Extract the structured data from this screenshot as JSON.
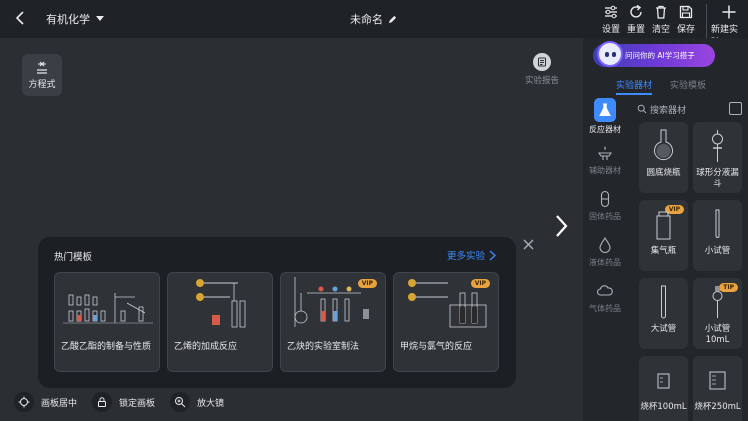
{
  "topbar": {
    "subject": "有机化学",
    "title": "未命名",
    "tools": {
      "settings": "设置",
      "reset": "重置",
      "clear": "清空",
      "save": "保存",
      "new_experiment": "新建实验"
    }
  },
  "canvas": {
    "equation_label": "方程式",
    "report_label": "实验报告"
  },
  "templates": {
    "heading": "热门模板",
    "more": "更多实验",
    "cards": [
      {
        "label": "乙酸乙酯的制备与性质",
        "vip": ""
      },
      {
        "label": "乙烯的加成反应",
        "vip": ""
      },
      {
        "label": "乙炔的实验室制法",
        "vip": "VIP"
      },
      {
        "label": "甲烷与氯气的反应",
        "vip": "VIP"
      }
    ]
  },
  "bottom_controls": {
    "center": "画板居中",
    "lock": "锁定画板",
    "magnifier": "放大镜"
  },
  "panel": {
    "ai_banner": "问问你的 AI学习搭子",
    "tabs": {
      "equipment": "实验器材",
      "templates": "实验模板"
    },
    "categories": [
      {
        "label": "反应器材",
        "icon": "flask-icon",
        "active": true
      },
      {
        "label": "辅助器材",
        "icon": "burner-icon",
        "active": false
      },
      {
        "label": "固体药品",
        "icon": "capsule-icon",
        "active": false
      },
      {
        "label": "液体药品",
        "icon": "drop-icon",
        "active": false
      },
      {
        "label": "气体药品",
        "icon": "cloud-icon",
        "active": false
      }
    ],
    "search_placeholder": "搜索器材",
    "items": [
      {
        "name": "圆底烧瓶",
        "badge": ""
      },
      {
        "name": "球形分液漏斗",
        "badge": ""
      },
      {
        "name": "集气瓶",
        "badge": "VIP"
      },
      {
        "name": "小试管",
        "badge": ""
      },
      {
        "name": "大试管",
        "badge": ""
      },
      {
        "name": "小试管10mL",
        "badge": "TIP"
      },
      {
        "name": "烧杯100mL",
        "badge": ""
      },
      {
        "name": "烧杯250mL",
        "badge": ""
      }
    ]
  },
  "colors": {
    "accent": "#3d8bff",
    "vip": "#e8a33d",
    "background": "#2b2e33",
    "panel": "#23262a"
  }
}
